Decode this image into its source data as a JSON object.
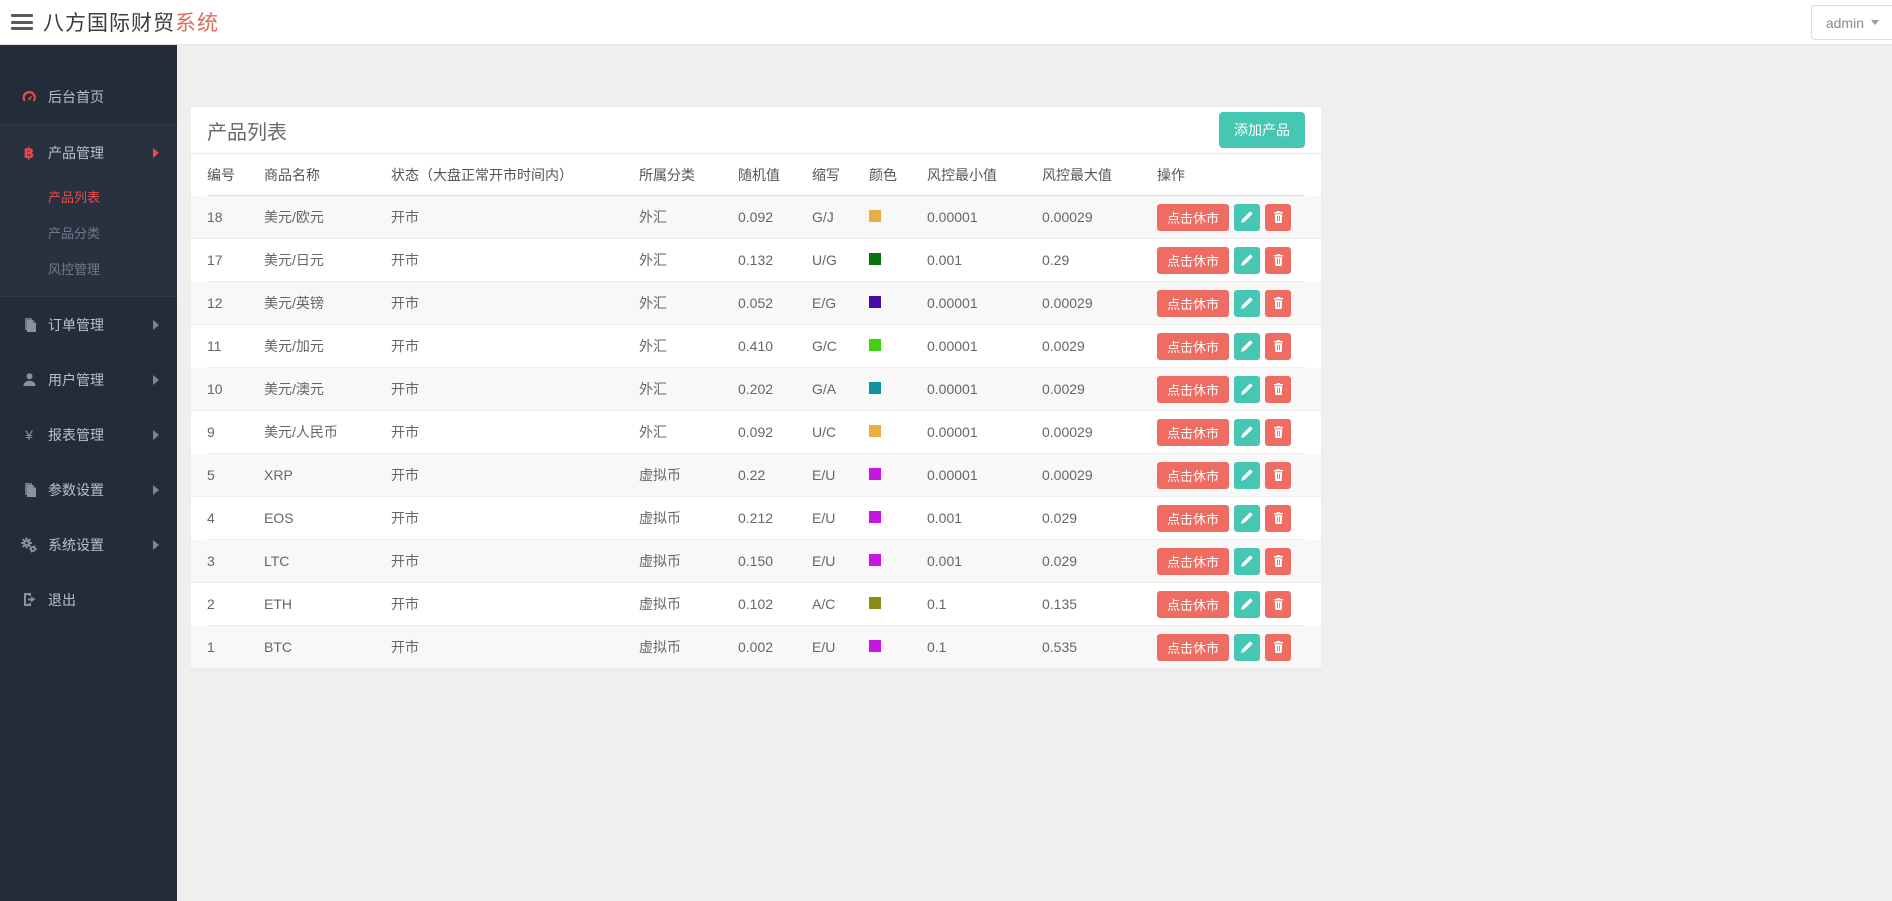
{
  "header": {
    "brand": "八方国际财贸",
    "brand_accent": "系统",
    "user": "admin"
  },
  "sidebar": {
    "items": [
      {
        "label": "后台首页",
        "icon": "dashboard-icon"
      },
      {
        "label": "产品管理",
        "icon": "bitcoin-icon",
        "expanded": true,
        "children": [
          "产品列表",
          "产品分类",
          "风控管理"
        ]
      },
      {
        "label": "订单管理",
        "icon": "orders-icon"
      },
      {
        "label": "用户管理",
        "icon": "user-icon"
      },
      {
        "label": "报表管理",
        "icon": "yen-icon"
      },
      {
        "label": "参数设置",
        "icon": "params-icon"
      },
      {
        "label": "系统设置",
        "icon": "gears-icon"
      },
      {
        "label": "退出",
        "icon": "logout-icon"
      }
    ]
  },
  "page": {
    "title": "产品列表",
    "add_button": "添加产品"
  },
  "table": {
    "headers": [
      "编号",
      "商品名称",
      "状态（大盘正常开市时间内）",
      "所属分类",
      "随机值",
      "缩写",
      "颜色",
      "风控最小值",
      "风控最大值",
      "操作"
    ],
    "close_market_label": "点击休市",
    "rows": [
      {
        "id": "18",
        "name": "美元/欧元",
        "status": "开市",
        "category": "外汇",
        "random": "0.092",
        "abbr": "G/J",
        "color": "#e9ad41",
        "min": "0.00001",
        "max": "0.00029"
      },
      {
        "id": "17",
        "name": "美元/日元",
        "status": "开市",
        "category": "外汇",
        "random": "0.132",
        "abbr": "U/G",
        "color": "#077407",
        "min": "0.001",
        "max": "0.29"
      },
      {
        "id": "12",
        "name": "美元/英镑",
        "status": "开市",
        "category": "外汇",
        "random": "0.052",
        "abbr": "E/G",
        "color": "#4b0ba6",
        "min": "0.00001",
        "max": "0.00029"
      },
      {
        "id": "11",
        "name": "美元/加元",
        "status": "开市",
        "category": "外汇",
        "random": "0.410",
        "abbr": "G/C",
        "color": "#3fd30d",
        "min": "0.00001",
        "max": "0.0029"
      },
      {
        "id": "10",
        "name": "美元/澳元",
        "status": "开市",
        "category": "外汇",
        "random": "0.202",
        "abbr": "G/A",
        "color": "#12929e",
        "min": "0.00001",
        "max": "0.0029"
      },
      {
        "id": "9",
        "name": "美元/人民币",
        "status": "开市",
        "category": "外汇",
        "random": "0.092",
        "abbr": "U/C",
        "color": "#e9ad41",
        "min": "0.00001",
        "max": "0.00029"
      },
      {
        "id": "5",
        "name": "XRP",
        "status": "开市",
        "category": "虚拟币",
        "random": "0.22",
        "abbr": "E/U",
        "color": "#c713e4",
        "min": "0.00001",
        "max": "0.00029"
      },
      {
        "id": "4",
        "name": "EOS",
        "status": "开市",
        "category": "虚拟币",
        "random": "0.212",
        "abbr": "E/U",
        "color": "#c713e4",
        "min": "0.001",
        "max": "0.029"
      },
      {
        "id": "3",
        "name": "LTC",
        "status": "开市",
        "category": "虚拟币",
        "random": "0.150",
        "abbr": "E/U",
        "color": "#c713e4",
        "min": "0.001",
        "max": "0.029"
      },
      {
        "id": "2",
        "name": "ETH",
        "status": "开市",
        "category": "虚拟币",
        "random": "0.102",
        "abbr": "A/C",
        "color": "#8b8b10",
        "min": "0.1",
        "max": "0.135"
      },
      {
        "id": "1",
        "name": "BTC",
        "status": "开市",
        "category": "虚拟币",
        "random": "0.002",
        "abbr": "E/U",
        "color": "#c713e4",
        "min": "0.1",
        "max": "0.535"
      }
    ]
  },
  "colors": {
    "teal_button": "#45c7b3",
    "red_button": "#ef6c62",
    "sidebar_bg": "#232d3a",
    "active_menu_red": "#e64c4c",
    "brand_accent_red": "#d96b61"
  }
}
